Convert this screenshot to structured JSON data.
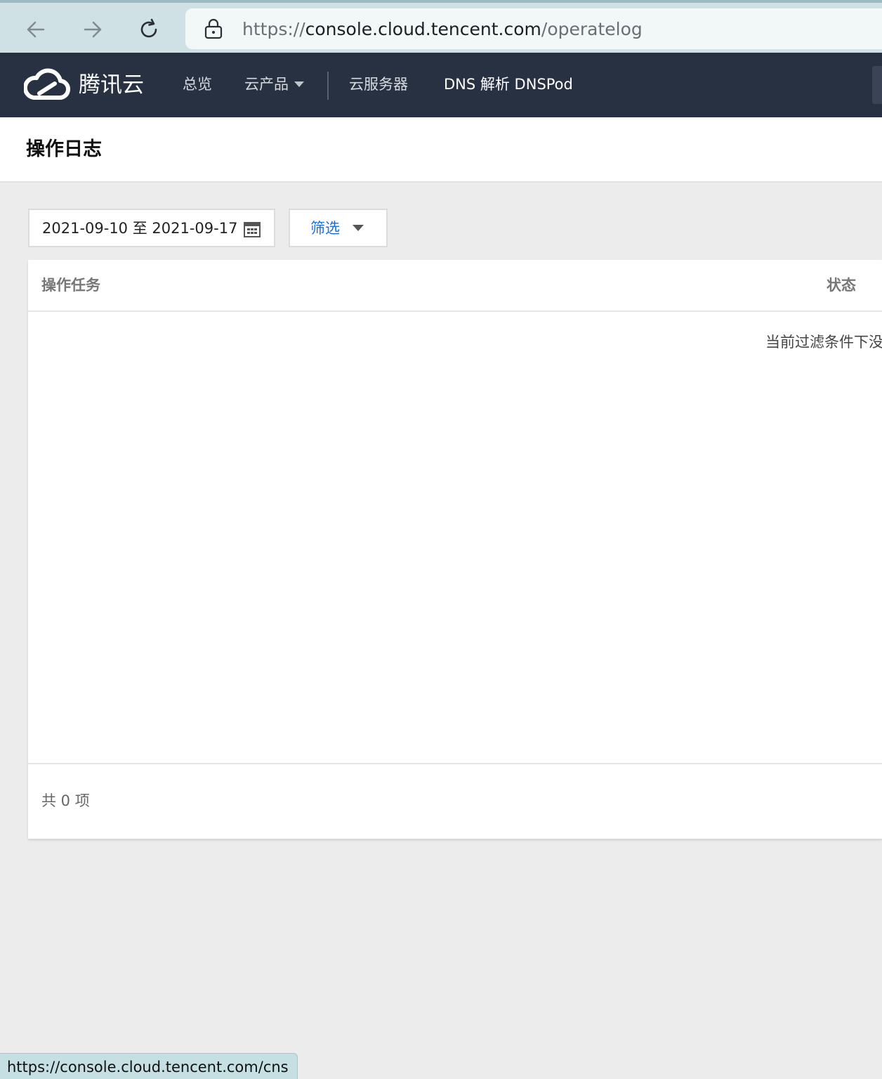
{
  "browser": {
    "url_scheme": "https://",
    "url_host": "console.cloud.tencent.com",
    "url_path": "/operatelog"
  },
  "topnav": {
    "brand": "腾讯云",
    "items": [
      {
        "label": "总览"
      },
      {
        "label": "云产品"
      },
      {
        "label": "云服务器"
      },
      {
        "label": "DNS 解析 DNSPod"
      }
    ]
  },
  "page": {
    "title": "操作日志"
  },
  "filters": {
    "date_range": "2021-09-10 至 2021-09-17",
    "filter_label": "筛选"
  },
  "table": {
    "columns": [
      "操作任务",
      "状态"
    ],
    "empty_message": "当前过滤条件下没",
    "total": "共 0 项"
  },
  "status_bar": {
    "url": "https://console.cloud.tencent.com/cns"
  }
}
